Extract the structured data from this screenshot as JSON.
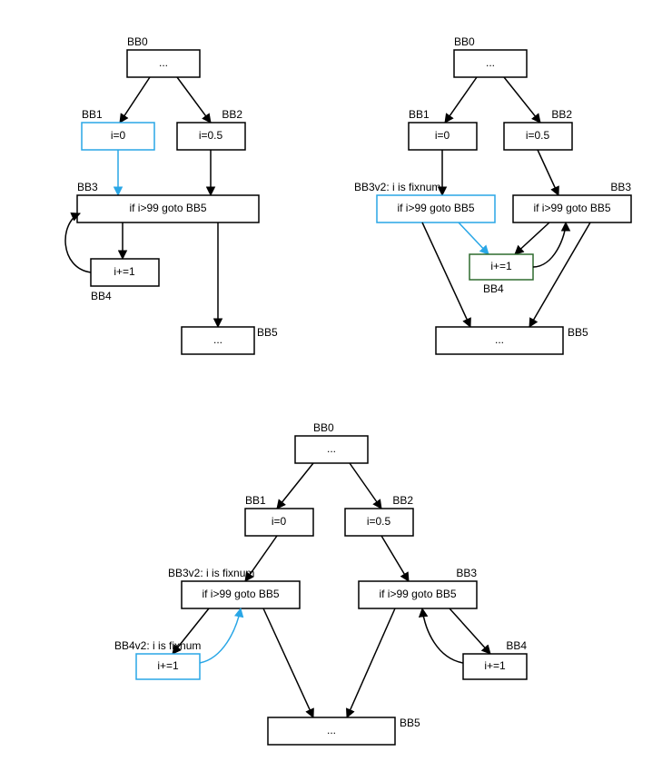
{
  "diagrams": {
    "A": {
      "bb0": {
        "label": "BB0",
        "text": "..."
      },
      "bb1": {
        "label": "BB1",
        "text": "i=0"
      },
      "bb2": {
        "label": "BB2",
        "text": "i=0.5"
      },
      "bb3": {
        "label": "BB3",
        "text": "if i>99 goto BB5"
      },
      "bb4": {
        "label": "BB4",
        "text": "i+=1"
      },
      "bb5": {
        "label": "BB5",
        "text": "..."
      }
    },
    "B": {
      "bb0": {
        "label": "BB0",
        "text": "..."
      },
      "bb1": {
        "label": "BB1",
        "text": "i=0"
      },
      "bb2": {
        "label": "BB2",
        "text": "i=0.5"
      },
      "bb3v2": {
        "label": "BB3v2: i is fixnum",
        "text": "if i>99 goto BB5"
      },
      "bb3": {
        "label": "BB3",
        "text": "if i>99 goto BB5"
      },
      "bb4": {
        "label": "BB4",
        "text": "i+=1"
      },
      "bb5": {
        "label": "BB5",
        "text": "..."
      }
    },
    "C": {
      "bb0": {
        "label": "BB0",
        "text": "..."
      },
      "bb1": {
        "label": "BB1",
        "text": "i=0"
      },
      "bb2": {
        "label": "BB2",
        "text": "i=0.5"
      },
      "bb3v2": {
        "label": "BB3v2: i is fixnum",
        "text": "if i>99 goto BB5"
      },
      "bb3": {
        "label": "BB3",
        "text": "if i>99 goto BB5"
      },
      "bb4v2": {
        "label": "BB4v2: i is fixnum",
        "text": "i+=1"
      },
      "bb4": {
        "label": "BB4",
        "text": "i+=1"
      },
      "bb5": {
        "label": "BB5",
        "text": "..."
      }
    }
  }
}
